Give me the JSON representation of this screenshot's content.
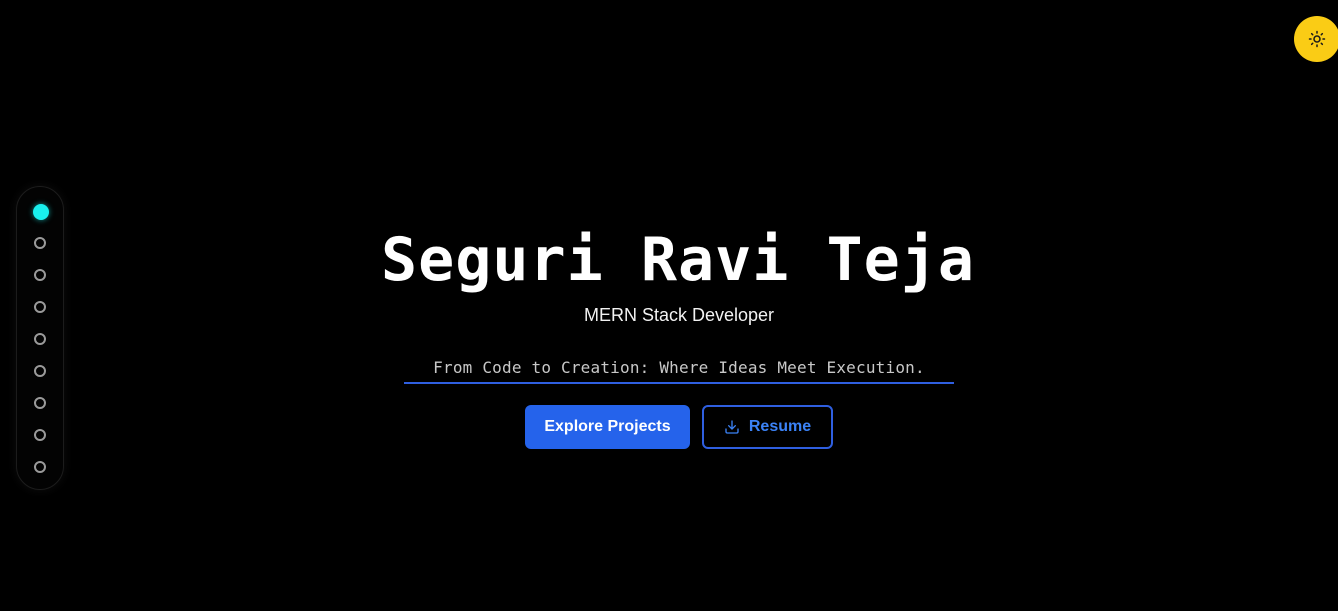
{
  "hero": {
    "name": "Seguri Ravi Teja",
    "role": "MERN Stack Developer",
    "tagline": "From Code to Creation: Where Ideas Meet Execution."
  },
  "buttons": {
    "explore_label": "Explore Projects",
    "resume_label": "Resume",
    "resume_icon": "download-icon"
  },
  "theme_toggle": {
    "icon": "sun-icon",
    "color": "#facc15"
  },
  "section_nav": {
    "count": 9,
    "active_index": 0,
    "active_color": "#19f0ee"
  },
  "colors": {
    "background": "#000000",
    "accent": "#2563eb"
  }
}
